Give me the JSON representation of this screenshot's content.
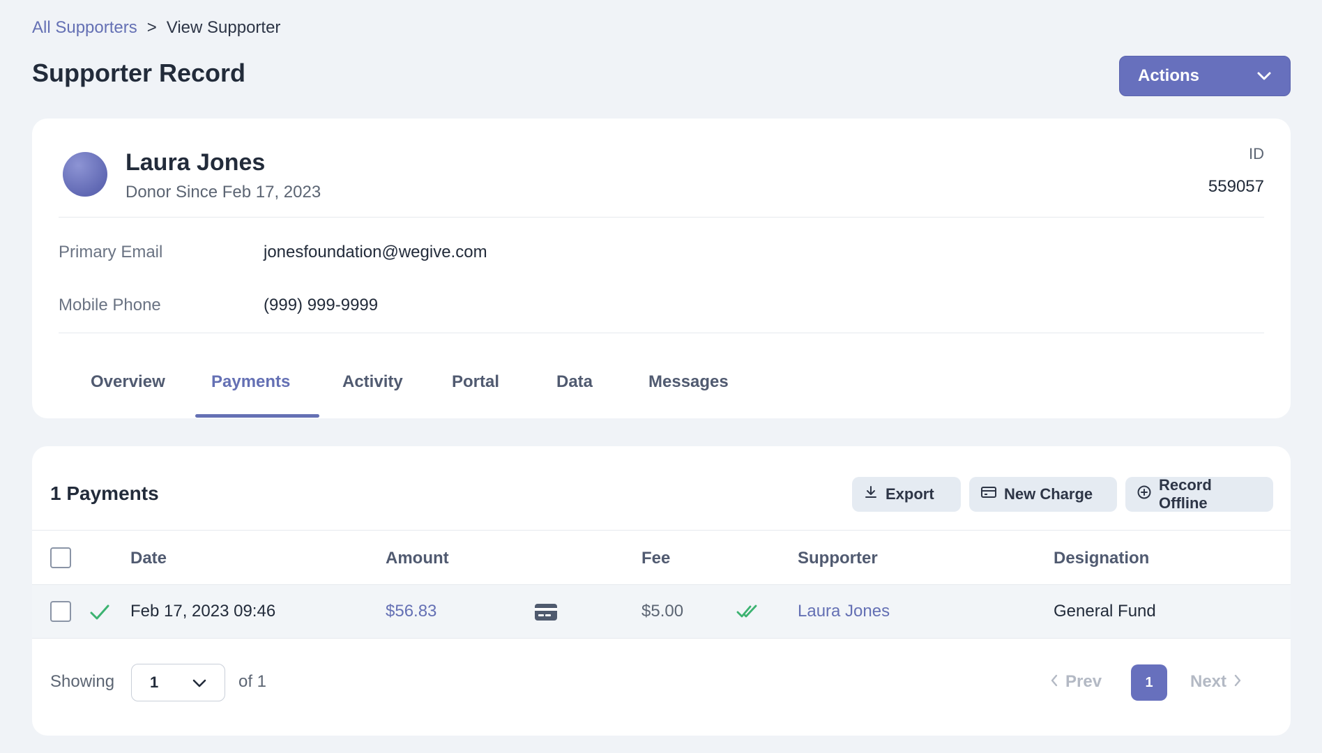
{
  "breadcrumb": {
    "parent": "All Supporters",
    "separator": ">",
    "current": "View Supporter"
  },
  "header": {
    "title": "Supporter Record",
    "actions_label": "Actions"
  },
  "profile": {
    "name": "Laura Jones",
    "since": "Donor Since Feb 17, 2023",
    "id_label": "ID",
    "id_value": "559057",
    "fields": [
      {
        "label": "Primary Email",
        "value": "jonesfoundation@wegive.com"
      },
      {
        "label": "Mobile Phone",
        "value": "(999) 999-9999"
      }
    ]
  },
  "tabs": [
    {
      "label": "Overview"
    },
    {
      "label": "Payments",
      "active": true
    },
    {
      "label": "Activity"
    },
    {
      "label": "Portal"
    },
    {
      "label": "Data"
    },
    {
      "label": "Messages"
    }
  ],
  "payments": {
    "title": "1 Payments",
    "toolbar": {
      "export": "Export",
      "new_charge": "New Charge",
      "record_offline": "Record Offline"
    },
    "columns": [
      "Date",
      "Amount",
      "Fee",
      "Supporter",
      "Designation"
    ],
    "rows": [
      {
        "status_icon": "check-icon",
        "date": "Feb 17, 2023 09:46",
        "amount": "$56.83",
        "method_icon": "credit-card-icon",
        "fee": "$5.00",
        "fee_icon": "double-check-icon",
        "supporter": "Laura Jones",
        "designation": "General Fund"
      }
    ],
    "pagination": {
      "showing_label": "Showing",
      "page_size": "1",
      "of_label": "of 1",
      "prev": "Prev",
      "current_page": "1",
      "next": "Next"
    }
  },
  "colors": {
    "accent": "#6770bd",
    "link": "#6470b4",
    "success": "#3cb371",
    "background": "#f0f3f7"
  }
}
